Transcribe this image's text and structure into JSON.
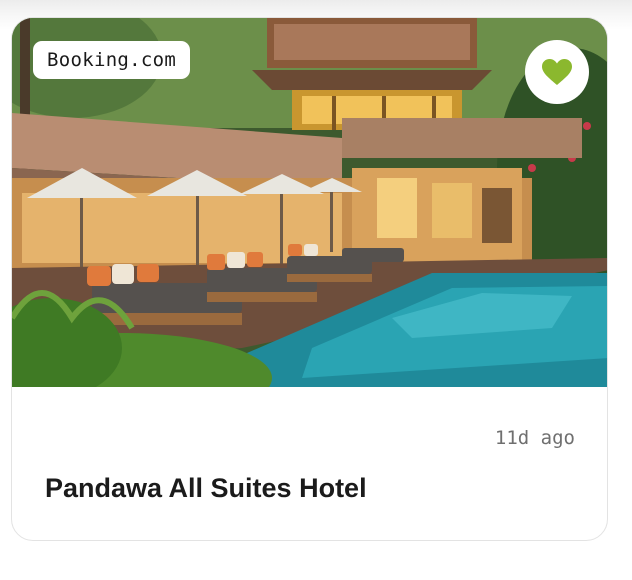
{
  "listing": {
    "source": "Booking.com",
    "time_ago": "11d ago",
    "title": "Pandawa All Suites Hotel",
    "favorite_icon": "heart-icon",
    "favorite_color": "#8bb82e",
    "image_subject": "resort-pool-photo"
  }
}
